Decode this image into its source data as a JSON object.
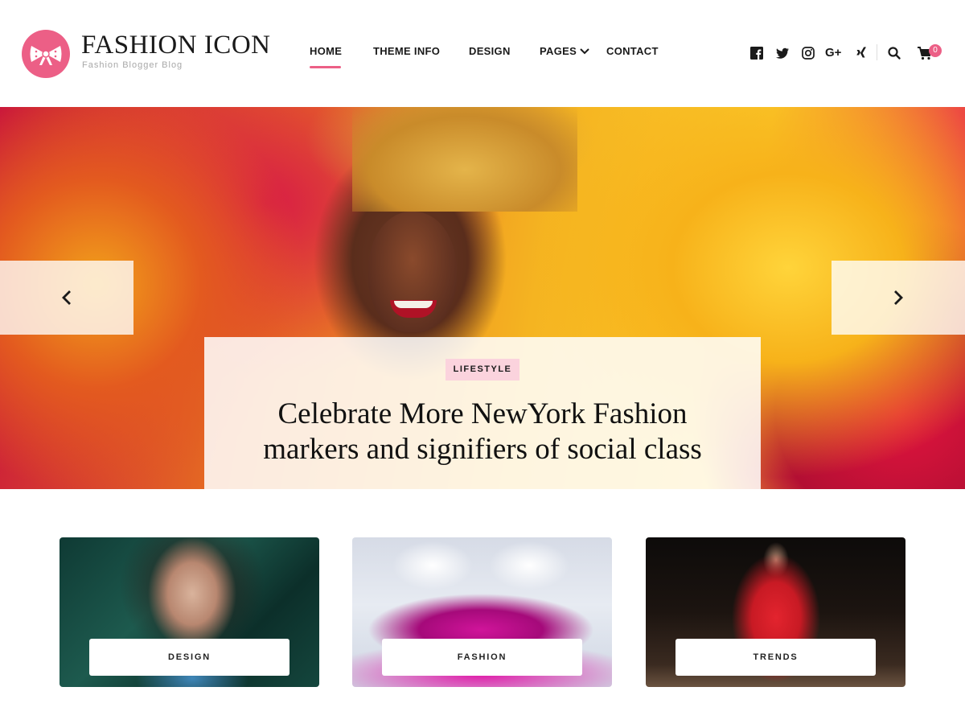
{
  "site": {
    "title": "FASHION ICON",
    "tagline": "Fashion Blogger Blog"
  },
  "nav": {
    "items": [
      "HOME",
      "THEME INFO",
      "DESIGN",
      "PAGES",
      "CONTACT"
    ],
    "active": "HOME"
  },
  "header_icons": [
    "facebook-icon",
    "twitter-icon",
    "instagram-icon",
    "google-plus-icon",
    "xing-icon",
    "search-icon",
    "cart-icon"
  ],
  "social": {
    "google_plus_label": "G+"
  },
  "cart": {
    "count": "0"
  },
  "hero": {
    "category": "LIFESTYLE",
    "title_line1": "Celebrate More NewYork Fashion",
    "title_line2": "markers and signifiers of social class"
  },
  "categories": [
    {
      "label": "DESIGN"
    },
    {
      "label": "FASHION"
    },
    {
      "label": "TRENDS"
    }
  ],
  "colors": {
    "accent": "#ec5f86",
    "tag_bg": "#fbd3dd",
    "text": "#1a1a1a"
  }
}
